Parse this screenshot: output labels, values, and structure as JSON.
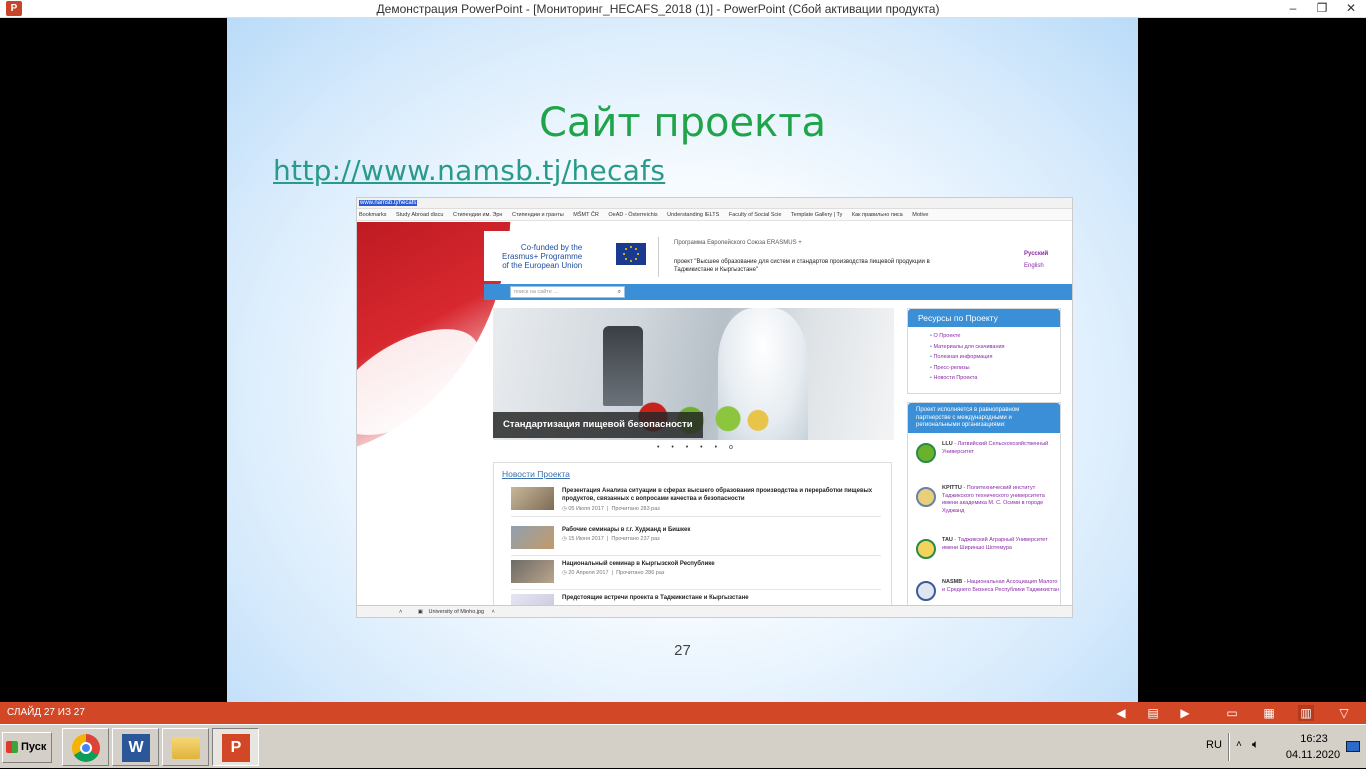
{
  "window": {
    "title": "Демонстрация PowerPoint - [Мониторинг_HECAFS_2018 (1)] - PowerPoint (Сбой активации продукта)",
    "app_icon": "powerpoint-icon"
  },
  "slide": {
    "title": "Сайт проекта",
    "link": "http://www.namsb.tj/hecafs",
    "number": "27"
  },
  "screenshot": {
    "url": "www.namsb.tj/hecafs",
    "bookmarks": [
      "Bookmarks",
      "Study Abroad discu",
      "Стипендии им. Эрн",
      "Стипендии и гранты",
      "MŠMT ČR",
      "OeAD - Österreichis",
      "Understanding IELTS",
      "Faculty of Social Scie",
      "Template Gallery | Ty",
      "Как правильно писа",
      "Motive"
    ],
    "eu_text": [
      "Co-funded by the",
      "Erasmus+ Programme",
      "of the European Union"
    ],
    "program": "Программа Европейского Союза ERASMUS +",
    "project": "проект \"Высшее образование для систем и стандартов производства пищевой продукции в Таджикистане и Кыргызстане\"",
    "lang_active": "Русский",
    "lang_other": "English",
    "search_placeholder": "поиск на сайте ...",
    "hero_caption": "Стандартизация пищевой безопасности",
    "slider_dots": "• • • • • o",
    "news_title": "Новости Проекта",
    "news": [
      {
        "title": "Презентация Анализа ситуации в сферах высшего образования производства и переработки пищевых продуктов, связанных с вопросами качества и безопасности",
        "date": "05 Июля 2017",
        "views": "Прочитано 283 раз"
      },
      {
        "title": "Рабочие семинары в г.г. Худжанд и Бишкек",
        "date": "15 Июня 2017",
        "views": "Прочитано 237 раз"
      },
      {
        "title": "Национальный семинар в Кыргызской Республике",
        "date": "20 Апреля 2017",
        "views": "Прочитано 286 раз"
      },
      {
        "title": "Предстоящие встречи проекта в Таджикистане и Кыргызстане",
        "date": "",
        "views": ""
      }
    ],
    "resources_title": "Ресурсы по Проекту",
    "resources": [
      "О Проекте",
      "Материалы для скачивания",
      "Полезная информация",
      "Пресс-релизы",
      "Новости Проекта"
    ],
    "partners_title": "Проект исполняется в равноправном партнерстве с международными и региональными организациями:",
    "partners": [
      {
        "abbr": "LLU",
        "name": " - Латвийский Сельскохозяйственный Университет"
      },
      {
        "abbr": "KPITTU",
        "name": " - Политехнический институт Таджикского технического университета имени академика М. С. Осими в городе Худжанд"
      },
      {
        "abbr": "TAU",
        "name": " - Таджикский Аграрный Университет имени Шириншо Шотемура"
      },
      {
        "abbr": "NASMB",
        "name": " - Национальная Ассоциация Малого и Среднего Бизнеса Республики Таджикистан"
      }
    ],
    "download": "University of Minho.jpg"
  },
  "statusbar": {
    "slide_counter": "СЛАЙД 27 ИЗ 27"
  },
  "taskbar": {
    "start": "Пуск",
    "lang": "RU",
    "time": "16:23",
    "date": "04.11.2020"
  },
  "colors": {
    "title_green": "#1fa44a",
    "statusbar": "#d24726",
    "link_teal": "#2a9a8a"
  }
}
